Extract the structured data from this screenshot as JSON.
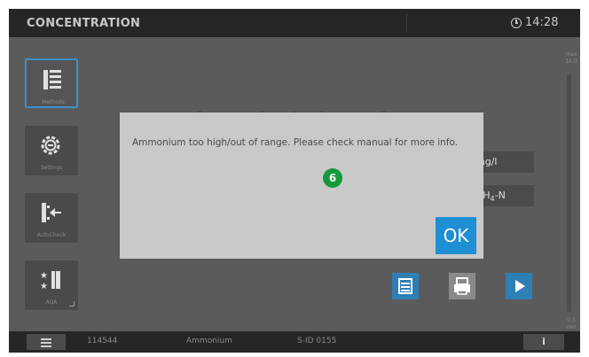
{
  "header": {
    "title": "CONCENTRATION",
    "time": "14:28"
  },
  "sidebar": {
    "items": [
      {
        "label": "Methods",
        "icon": "method-list-icon",
        "active": true
      },
      {
        "label": "Settings",
        "icon": "gear-icon",
        "active": false
      },
      {
        "label": "AutoCheck",
        "icon": "autocheck-icon",
        "active": false
      },
      {
        "label": "AQA",
        "icon": "aqa-icon",
        "active": false
      }
    ]
  },
  "scale": {
    "max_label": "max",
    "max_value": "16.0",
    "min_value": "0.5",
    "min_label": "min"
  },
  "result": {
    "unit": "mg/l",
    "form": "NH4-N"
  },
  "status_bar": {
    "method_number": "114544",
    "method_name": "Ammonium",
    "sid": "S-ID 0155",
    "info": "i"
  },
  "dialog": {
    "message": "Ammonium too high/out of range. Please check manual for more info.",
    "ok_label": "OK",
    "badge": "6"
  },
  "colors": {
    "accent": "#1f8fd3",
    "badge": "#159a3b",
    "dialog_bg": "#c9c9c9",
    "topbar": "#262626"
  }
}
